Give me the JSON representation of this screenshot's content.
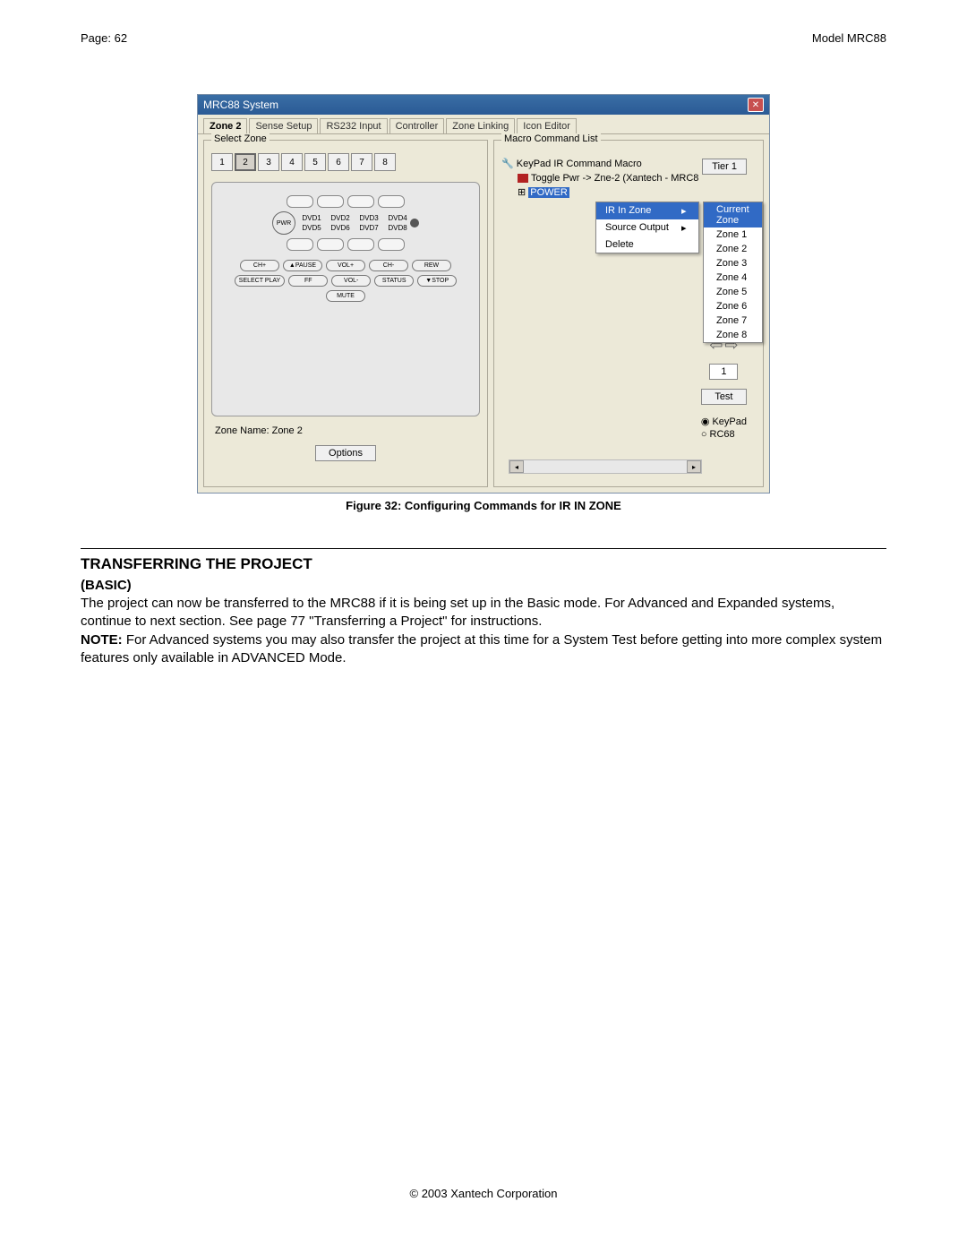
{
  "header": {
    "left": "Page: 62",
    "right": "Model MRC88"
  },
  "window": {
    "title": "MRC88 System",
    "tabs": [
      "Zone 2",
      "Sense Setup",
      "RS232 Input",
      "Controller",
      "Zone Linking",
      "Icon Editor"
    ],
    "selectZone": {
      "title": "Select Zone",
      "numbers": [
        "1",
        "2",
        "3",
        "4",
        "5",
        "6",
        "7",
        "8"
      ],
      "keypad": {
        "pwr": "PWR",
        "row1": [
          "DVD1",
          "DVD2",
          "DVD3",
          "DVD4"
        ],
        "row2": [
          "DVD5",
          "DVD6",
          "DVD7",
          "DVD8"
        ],
        "controls": [
          "CH+",
          "▲PAUSE",
          "VOL+",
          "CH-",
          "REW",
          "SELECT PLAY",
          "FF",
          "VOL-",
          "STATUS",
          "▼STOP",
          "MUTE"
        ]
      },
      "zoneNameLabel": "Zone Name:",
      "zoneNameValue": "Zone 2",
      "options": "Options"
    },
    "macro": {
      "title": "Macro Command List",
      "tree": {
        "root": "KeyPad IR Command Macro",
        "toggle": "Toggle Pwr -> Zne-2 (Xantech - MRC8",
        "power": "POWER",
        "irin": "IR In Zone",
        "current": "Current Zone"
      },
      "tier": "Tier 1",
      "menu": {
        "item1": "IR In Zone",
        "item2": "Source Output",
        "item3": "Delete",
        "arrow": "▸"
      },
      "submenu": {
        "current": "Current Zone",
        "zones": [
          "Zone 1",
          "Zone 2",
          "Zone 3",
          "Zone 4",
          "Zone 5",
          "Zone 6",
          "Zone 7",
          "Zone 8"
        ]
      },
      "num": "1",
      "test": "Test",
      "radios": {
        "keypad": "KeyPad",
        "rc68": "RC68"
      }
    }
  },
  "caption": "Figure 32: Configuring Commands for IR IN ZONE",
  "section": {
    "title": "TRANSFERRING THE PROJECT",
    "sub": "(BASIC)",
    "p1": "The project can now be transferred to the MRC88 if it is being set up in the Basic mode. For Advanced and Expanded systems, continue to next section.  See page 77 \"Transferring a Project\" for instructions.",
    "p2a": "NOTE:",
    "p2b": " For Advanced systems you may also transfer the project at this time for a System Test before getting into more complex system features only available in ADVANCED Mode."
  },
  "footer": "© 2003 Xantech Corporation"
}
